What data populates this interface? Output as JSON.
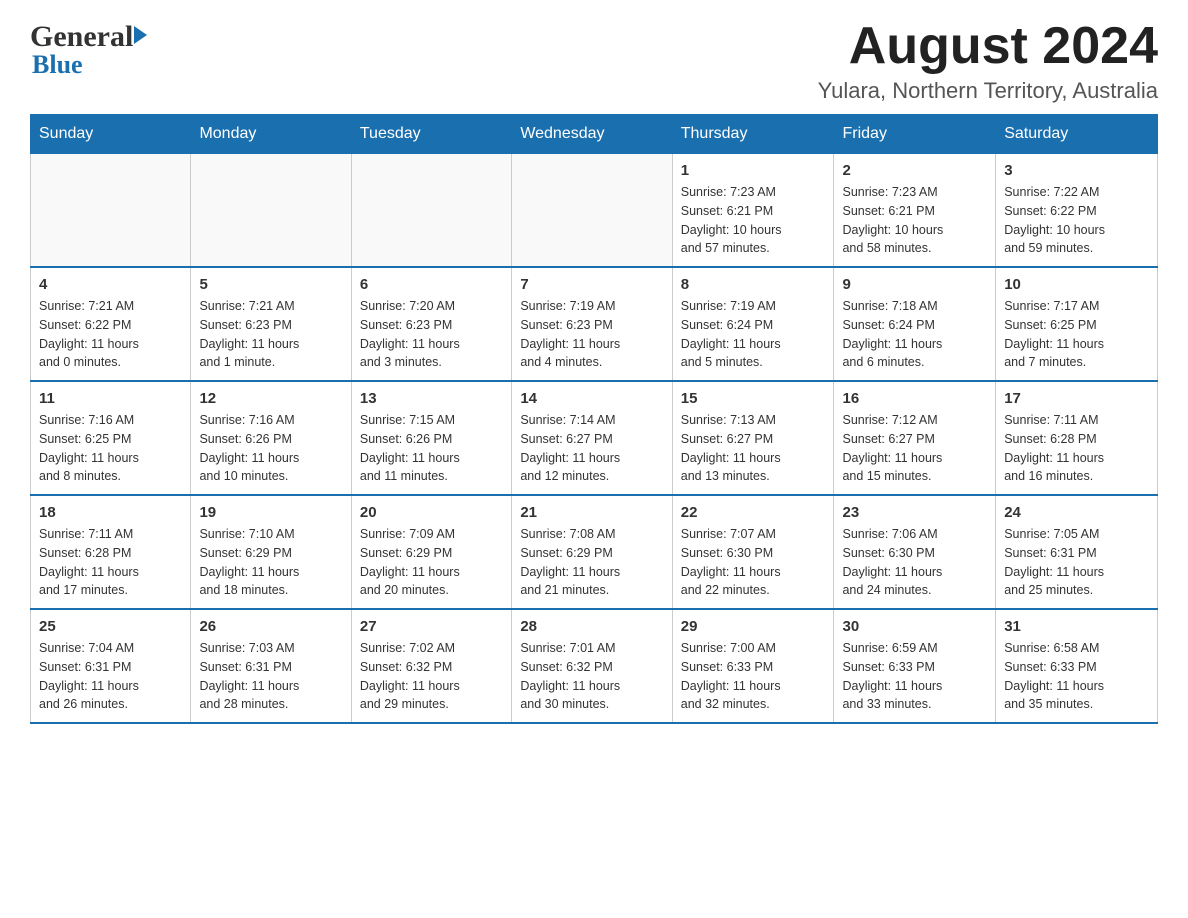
{
  "header": {
    "logo_general": "General",
    "logo_blue": "Blue",
    "month_year": "August 2024",
    "location": "Yulara, Northern Territory, Australia"
  },
  "days_of_week": [
    "Sunday",
    "Monday",
    "Tuesday",
    "Wednesday",
    "Thursday",
    "Friday",
    "Saturday"
  ],
  "weeks": [
    {
      "days": [
        {
          "num": "",
          "info": ""
        },
        {
          "num": "",
          "info": ""
        },
        {
          "num": "",
          "info": ""
        },
        {
          "num": "",
          "info": ""
        },
        {
          "num": "1",
          "info": "Sunrise: 7:23 AM\nSunset: 6:21 PM\nDaylight: 10 hours\nand 57 minutes."
        },
        {
          "num": "2",
          "info": "Sunrise: 7:23 AM\nSunset: 6:21 PM\nDaylight: 10 hours\nand 58 minutes."
        },
        {
          "num": "3",
          "info": "Sunrise: 7:22 AM\nSunset: 6:22 PM\nDaylight: 10 hours\nand 59 minutes."
        }
      ]
    },
    {
      "days": [
        {
          "num": "4",
          "info": "Sunrise: 7:21 AM\nSunset: 6:22 PM\nDaylight: 11 hours\nand 0 minutes."
        },
        {
          "num": "5",
          "info": "Sunrise: 7:21 AM\nSunset: 6:23 PM\nDaylight: 11 hours\nand 1 minute."
        },
        {
          "num": "6",
          "info": "Sunrise: 7:20 AM\nSunset: 6:23 PM\nDaylight: 11 hours\nand 3 minutes."
        },
        {
          "num": "7",
          "info": "Sunrise: 7:19 AM\nSunset: 6:23 PM\nDaylight: 11 hours\nand 4 minutes."
        },
        {
          "num": "8",
          "info": "Sunrise: 7:19 AM\nSunset: 6:24 PM\nDaylight: 11 hours\nand 5 minutes."
        },
        {
          "num": "9",
          "info": "Sunrise: 7:18 AM\nSunset: 6:24 PM\nDaylight: 11 hours\nand 6 minutes."
        },
        {
          "num": "10",
          "info": "Sunrise: 7:17 AM\nSunset: 6:25 PM\nDaylight: 11 hours\nand 7 minutes."
        }
      ]
    },
    {
      "days": [
        {
          "num": "11",
          "info": "Sunrise: 7:16 AM\nSunset: 6:25 PM\nDaylight: 11 hours\nand 8 minutes."
        },
        {
          "num": "12",
          "info": "Sunrise: 7:16 AM\nSunset: 6:26 PM\nDaylight: 11 hours\nand 10 minutes."
        },
        {
          "num": "13",
          "info": "Sunrise: 7:15 AM\nSunset: 6:26 PM\nDaylight: 11 hours\nand 11 minutes."
        },
        {
          "num": "14",
          "info": "Sunrise: 7:14 AM\nSunset: 6:27 PM\nDaylight: 11 hours\nand 12 minutes."
        },
        {
          "num": "15",
          "info": "Sunrise: 7:13 AM\nSunset: 6:27 PM\nDaylight: 11 hours\nand 13 minutes."
        },
        {
          "num": "16",
          "info": "Sunrise: 7:12 AM\nSunset: 6:27 PM\nDaylight: 11 hours\nand 15 minutes."
        },
        {
          "num": "17",
          "info": "Sunrise: 7:11 AM\nSunset: 6:28 PM\nDaylight: 11 hours\nand 16 minutes."
        }
      ]
    },
    {
      "days": [
        {
          "num": "18",
          "info": "Sunrise: 7:11 AM\nSunset: 6:28 PM\nDaylight: 11 hours\nand 17 minutes."
        },
        {
          "num": "19",
          "info": "Sunrise: 7:10 AM\nSunset: 6:29 PM\nDaylight: 11 hours\nand 18 minutes."
        },
        {
          "num": "20",
          "info": "Sunrise: 7:09 AM\nSunset: 6:29 PM\nDaylight: 11 hours\nand 20 minutes."
        },
        {
          "num": "21",
          "info": "Sunrise: 7:08 AM\nSunset: 6:29 PM\nDaylight: 11 hours\nand 21 minutes."
        },
        {
          "num": "22",
          "info": "Sunrise: 7:07 AM\nSunset: 6:30 PM\nDaylight: 11 hours\nand 22 minutes."
        },
        {
          "num": "23",
          "info": "Sunrise: 7:06 AM\nSunset: 6:30 PM\nDaylight: 11 hours\nand 24 minutes."
        },
        {
          "num": "24",
          "info": "Sunrise: 7:05 AM\nSunset: 6:31 PM\nDaylight: 11 hours\nand 25 minutes."
        }
      ]
    },
    {
      "days": [
        {
          "num": "25",
          "info": "Sunrise: 7:04 AM\nSunset: 6:31 PM\nDaylight: 11 hours\nand 26 minutes."
        },
        {
          "num": "26",
          "info": "Sunrise: 7:03 AM\nSunset: 6:31 PM\nDaylight: 11 hours\nand 28 minutes."
        },
        {
          "num": "27",
          "info": "Sunrise: 7:02 AM\nSunset: 6:32 PM\nDaylight: 11 hours\nand 29 minutes."
        },
        {
          "num": "28",
          "info": "Sunrise: 7:01 AM\nSunset: 6:32 PM\nDaylight: 11 hours\nand 30 minutes."
        },
        {
          "num": "29",
          "info": "Sunrise: 7:00 AM\nSunset: 6:33 PM\nDaylight: 11 hours\nand 32 minutes."
        },
        {
          "num": "30",
          "info": "Sunrise: 6:59 AM\nSunset: 6:33 PM\nDaylight: 11 hours\nand 33 minutes."
        },
        {
          "num": "31",
          "info": "Sunrise: 6:58 AM\nSunset: 6:33 PM\nDaylight: 11 hours\nand 35 minutes."
        }
      ]
    }
  ]
}
